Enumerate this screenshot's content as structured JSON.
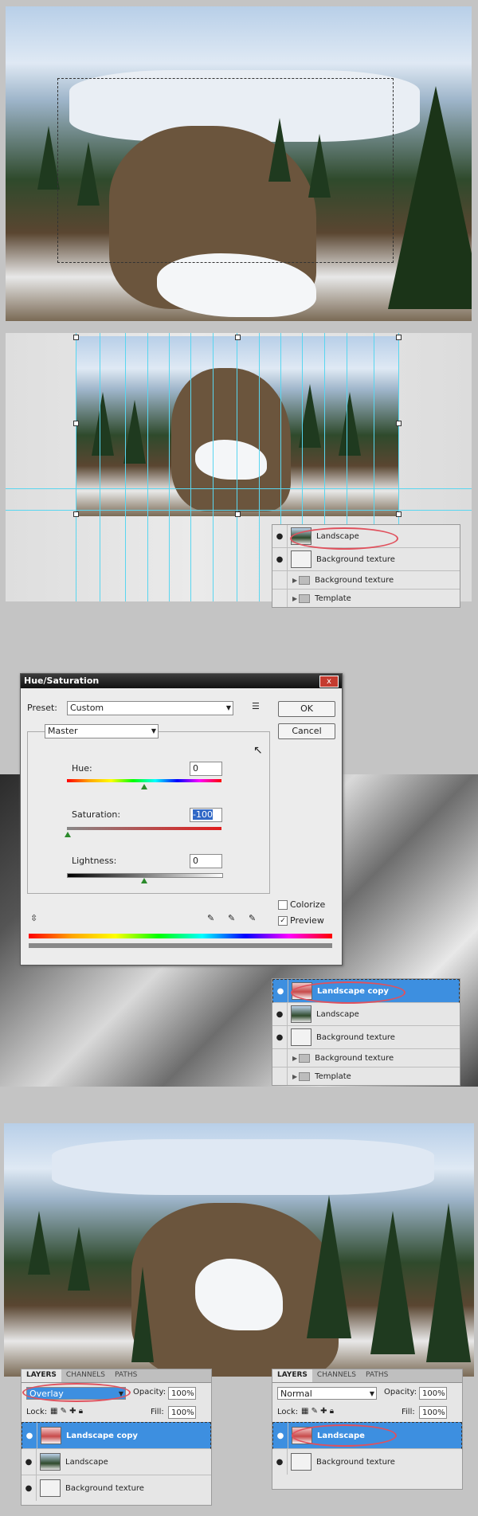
{
  "panel1": {},
  "panel2": {
    "layers": [
      {
        "name": "Landscape",
        "type": "image"
      },
      {
        "name": "Background texture",
        "type": "texture"
      },
      {
        "name": "Background texture",
        "type": "group"
      },
      {
        "name": "Template",
        "type": "group"
      }
    ]
  },
  "dialog": {
    "title": "Hue/Saturation",
    "close_label": "x",
    "preset_label": "Preset:",
    "preset_value": "Custom",
    "ok_label": "OK",
    "cancel_label": "Cancel",
    "channel_value": "Master",
    "hue_label": "Hue:",
    "hue_value": "0",
    "saturation_label": "Saturation:",
    "saturation_value": "-100",
    "lightness_label": "Lightness:",
    "lightness_value": "0",
    "colorize_label": "Colorize",
    "colorize_checked": false,
    "preview_label": "Preview",
    "preview_checked": true
  },
  "panel3": {
    "layers": [
      {
        "name": "Landscape copy",
        "selected": true
      },
      {
        "name": "Landscape"
      },
      {
        "name": "Background texture"
      },
      {
        "name": "Background texture",
        "type": "group"
      },
      {
        "name": "Template",
        "type": "group"
      }
    ]
  },
  "panel4_left": {
    "tabs": [
      "LAYERS",
      "CHANNELS",
      "PATHS"
    ],
    "blend_mode": "Overlay",
    "opacity_label": "Opacity:",
    "opacity_value": "100%",
    "lock_label": "Lock:",
    "fill_label": "Fill:",
    "fill_value": "100%",
    "layers": [
      "Landscape copy",
      "Landscape",
      "Background texture"
    ]
  },
  "panel4_right": {
    "tabs": [
      "LAYERS",
      "CHANNELS",
      "PATHS"
    ],
    "blend_mode": "Normal",
    "opacity_label": "Opacity:",
    "opacity_value": "100%",
    "lock_label": "Lock:",
    "fill_label": "Fill:",
    "fill_value": "100%",
    "layers": [
      "Landscape",
      "Background texture"
    ]
  },
  "colors": {
    "selection": "#3d8fe0",
    "highlight_oval": "#e0515d",
    "guide": "#59d6f0"
  }
}
